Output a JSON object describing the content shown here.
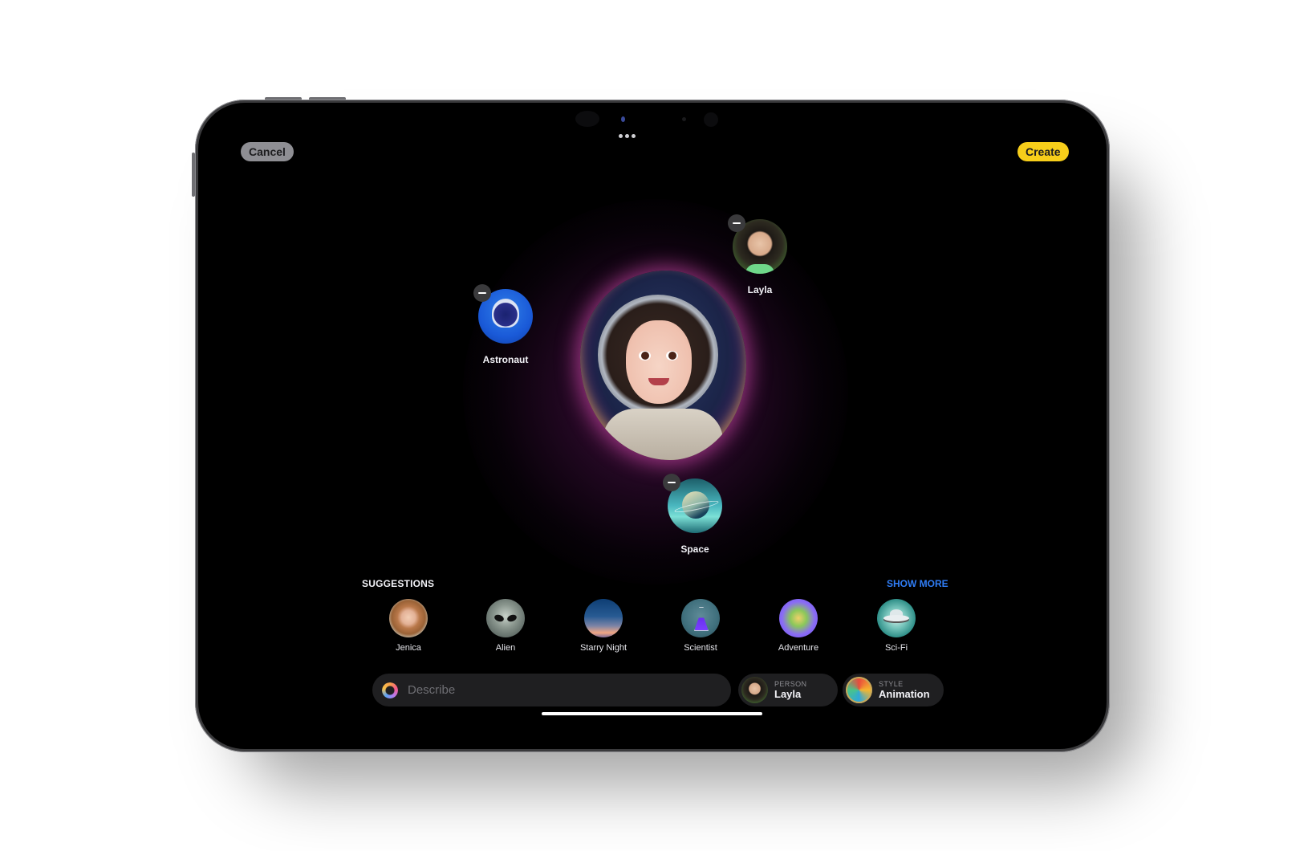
{
  "toolbar": {
    "cancel_label": "Cancel",
    "create_label": "Create",
    "more_icon": "ellipsis-icon"
  },
  "canvas": {
    "hero": "generated-image-astronaut-portrait",
    "concepts": [
      {
        "label": "Astronaut",
        "icon": "astronaut-helmet-icon"
      },
      {
        "label": "Layla",
        "icon": "person-photo"
      },
      {
        "label": "Space",
        "icon": "planet-icon"
      }
    ]
  },
  "suggestions": {
    "header": "SUGGESTIONS",
    "show_more": "SHOW MORE",
    "accent_color": "#2f7df6",
    "items": [
      {
        "label": "Jenica",
        "icon": "person-photo"
      },
      {
        "label": "Alien",
        "icon": "alien-icon"
      },
      {
        "label": "Starry Night",
        "icon": "starry-night-icon"
      },
      {
        "label": "Scientist",
        "icon": "flask-icon"
      },
      {
        "label": "Adventure",
        "icon": "map-icon"
      },
      {
        "label": "Sci-Fi",
        "icon": "ufo-icon"
      }
    ]
  },
  "bottom_bar": {
    "describe_placeholder": "Describe",
    "describe_value": "",
    "person": {
      "kicker": "PERSON",
      "value": "Layla"
    },
    "style": {
      "kicker": "STYLE",
      "value": "Animation"
    }
  },
  "colors": {
    "create_button": "#f7ce1a",
    "cancel_button": "#8e8e93",
    "glow": "#d04fa6"
  }
}
